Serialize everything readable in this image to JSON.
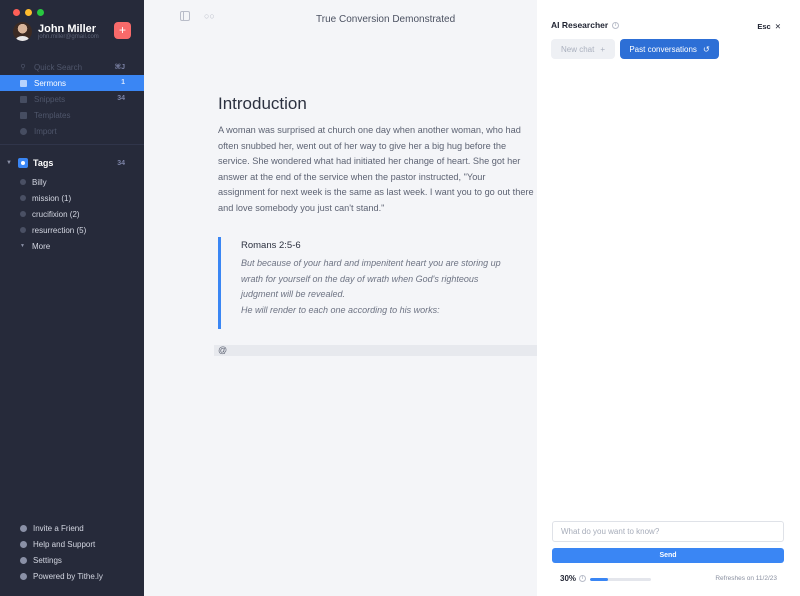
{
  "window": {
    "doc_title": "True Conversion Demonstrated"
  },
  "user": {
    "name": "John Miller",
    "email": "john.miller@gmail.com",
    "add_label": "+"
  },
  "nav": [
    {
      "label": "Quick Search",
      "badge": "⌘J",
      "icon": "search-icon",
      "active": false
    },
    {
      "label": "Sermons",
      "badge": "1",
      "icon": "book-icon",
      "active": true
    },
    {
      "label": "Snippets",
      "badge": "34",
      "icon": "snippet-icon",
      "active": false
    },
    {
      "label": "Templates",
      "badge": "",
      "icon": "template-icon",
      "active": false
    },
    {
      "label": "Import",
      "badge": "",
      "icon": "import-icon",
      "active": false
    }
  ],
  "tags": {
    "label": "Tags",
    "count": "34",
    "items": [
      "Billy",
      "mission (1)",
      "crucifixion (2)",
      "resurrection (5)"
    ],
    "more_label": "More"
  },
  "bottom_nav": [
    {
      "label": "Invite a Friend",
      "icon": "invite-icon"
    },
    {
      "label": "Help and Support",
      "icon": "help-icon"
    },
    {
      "label": "Settings",
      "icon": "gear-icon"
    },
    {
      "label": "Powered by Tithe.ly",
      "icon": "tithely-icon"
    }
  ],
  "doc": {
    "heading": "Introduction",
    "paragraph": "A woman was surprised at church one day when another woman, who had often snubbed her, went out of her way to give her a big hug before the service. She wondered what had initiated her change of heart. She got her answer at the end of the service when the pastor instructed, \"Your assignment for next week is the same as last week. I want you to go out there and love somebody you just can't stand.\"",
    "quote_ref": "Romans 2:5-6",
    "quote_lines": [
      "But because of your hard and impenitent heart you are storing up",
      "wrath for yourself on the day of wrath when God's righteous",
      "judgment will be revealed.",
      "He will render to each one according to his works:"
    ],
    "at_line": "@"
  },
  "panel": {
    "title": "AI Researcher",
    "esc_label": "Esc",
    "new_chat_label": "New chat",
    "past_label": "Past conversations",
    "input_placeholder": "What do you want to know?",
    "send_label": "Send",
    "usage_label": "30%",
    "usage_fraction": 0.3,
    "refresh_label": "Refreshes on 11/2/23"
  },
  "colors": {
    "accent": "#3a86f4",
    "sidebar": "#262a3a",
    "add_button": "#f86a6a"
  }
}
